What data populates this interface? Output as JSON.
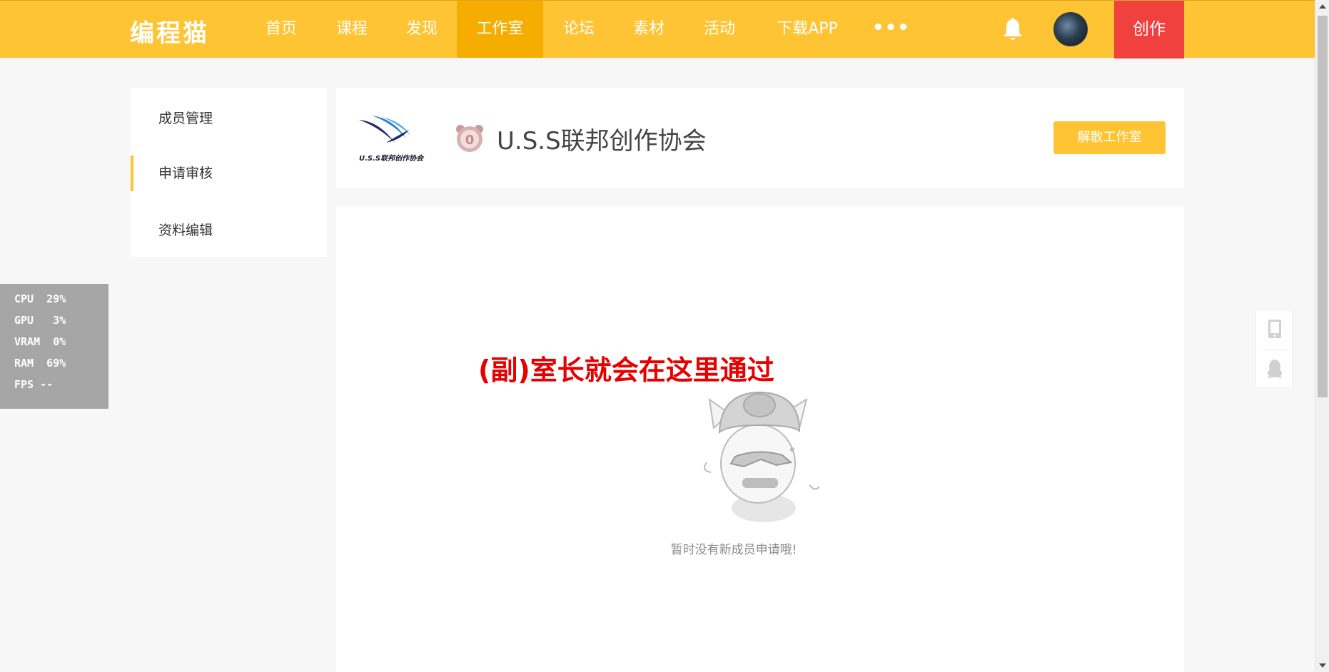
{
  "nav": {
    "logo": "编程猫",
    "items": [
      "首页",
      "课程",
      "发现",
      "工作室",
      "论坛",
      "素材",
      "活动",
      "下载APP"
    ],
    "active_item": "工作室",
    "more": "•••",
    "create": "创作"
  },
  "sidebar": {
    "items": [
      {
        "label": "成员管理"
      },
      {
        "label": "申请审核"
      },
      {
        "label": "资料编辑"
      }
    ],
    "active_item": "申请审核"
  },
  "studio": {
    "logo_text": "U.S.S联邦创作协会",
    "level": "0",
    "name": "U.S.S联邦创作协会",
    "dissolve_button": "解散工作室"
  },
  "main": {
    "annotation": "(副)室长就会在这里通过",
    "empty_message": "暂时没有新成员申请哦!"
  },
  "perf": {
    "rows": [
      {
        "label": "CPU",
        "value": "29%"
      },
      {
        "label": "GPU",
        "value": "3%"
      },
      {
        "label": "VRAM",
        "value": "0%"
      },
      {
        "label": "RAM",
        "value": "69%"
      },
      {
        "label": "FPS",
        "value": "--"
      }
    ]
  },
  "colors": {
    "brand_yellow": "#fec433",
    "active_nav": "#f5ad00",
    "create_red": "#f0413f",
    "annotation_red": "#e60000"
  },
  "icons": [
    "bell-icon",
    "avatar",
    "tablet-icon",
    "qq-penguin-icon",
    "level-badge-icon",
    "studio-logo"
  ]
}
